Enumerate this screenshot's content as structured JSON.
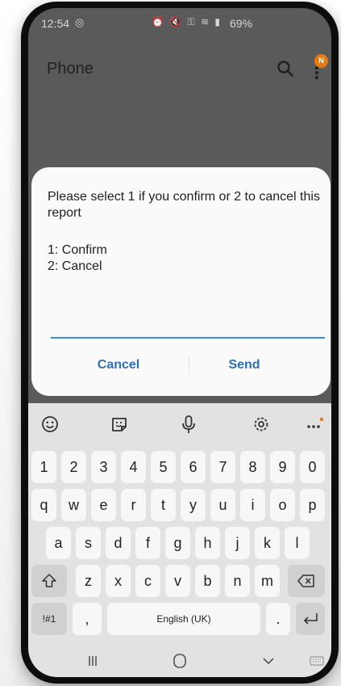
{
  "status_bar": {
    "time": "12:54",
    "time_icon": "screenshot-icon",
    "icons": "alarm mute nfc wifi signal",
    "battery": "69%"
  },
  "app_bar": {
    "title": "Phone",
    "badge": "N",
    "badge_color": "#e57a10"
  },
  "dialog": {
    "message": "Please select 1 if you confirm or 2 to cancel this report",
    "option_1": "1: Confirm",
    "option_2": "2: Cancel",
    "input_value": "",
    "cancel_label": "Cancel",
    "send_label": "Send",
    "accent_color": "#2f6fb3"
  },
  "keyboard": {
    "toolbar_icons": [
      "emoji-icon",
      "sticker-icon",
      "microphone-icon",
      "settings-icon",
      "more-options-icon"
    ],
    "row_numbers": [
      "1",
      "2",
      "3",
      "4",
      "5",
      "6",
      "7",
      "8",
      "9",
      "0"
    ],
    "row_top": [
      "q",
      "w",
      "e",
      "r",
      "t",
      "y",
      "u",
      "i",
      "o",
      "p"
    ],
    "row_middle": [
      "a",
      "s",
      "d",
      "f",
      "g",
      "h",
      "j",
      "k",
      "l"
    ],
    "row_bottom": [
      "z",
      "x",
      "c",
      "v",
      "b",
      "n",
      "m"
    ],
    "symbols_label": "!#1",
    "comma_label": ",",
    "space_label": "English (UK)",
    "period_label": "."
  },
  "nav_bar": {
    "icons": [
      "recent-apps-icon",
      "home-icon",
      "back-icon",
      "keyboard-hide-icon"
    ]
  }
}
